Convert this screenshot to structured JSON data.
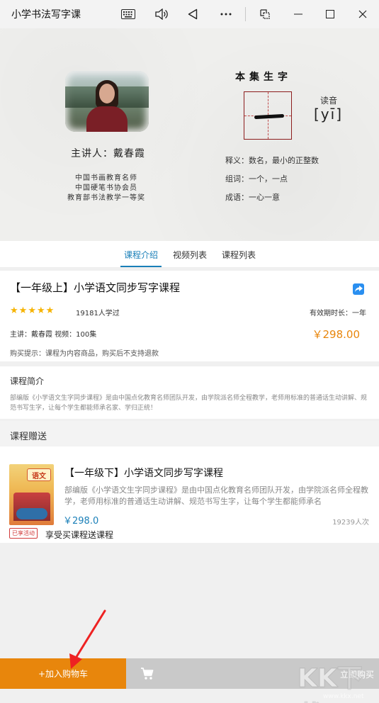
{
  "window": {
    "title": "小学书法写字课",
    "controls": [
      "keyboard-icon",
      "volume-icon",
      "back-icon",
      "more-icon",
      "snap-icon",
      "minimize-icon",
      "maximize-icon",
      "close-icon"
    ]
  },
  "banner": {
    "speaker": "主讲人：戴春霞",
    "credentials": [
      "中国书画教育名师",
      "中国硬笔书协会员",
      "教育部书法教学一等奖"
    ],
    "character_title": "本集生字",
    "character": "一",
    "pinyin_label": "读音",
    "pinyin": "[yī]",
    "meaning": "释义：数名，最小的正整数",
    "phrases": "组词：一个，一点",
    "idiom": "成语：一心一意"
  },
  "tabs": [
    {
      "label": "课程介绍",
      "active": true
    },
    {
      "label": "视频列表",
      "active": false
    },
    {
      "label": "课程列表",
      "active": false
    }
  ],
  "course": {
    "title": "【一年级上】小学语文同步写字课程",
    "rating": 5,
    "learners": "19181人学过",
    "validity": "有效期时长：一年",
    "meta": "主讲：戴春霞   视频：100集",
    "price": "￥298.00",
    "tip": "购买提示：课程为内容商品，购买后不支持退款"
  },
  "intro": {
    "heading": "课程简介",
    "body": "部编版《小学语文生字同步课程》是由中国点化教育名师团队开发，由学院派名师全程教学，老师用标准的普通话生动讲解、规范书写生字，让每个学生都能师承名家、学归正统！"
  },
  "gift": {
    "heading": "课程赠送",
    "cover_label": "语文",
    "title": "【一年级下】小学语文同步写字课程",
    "description": "部编版《小学语文生字同步课程》是由中国点化教育名师团队开发，由学院派名师全程教学，老师用标准的普通话生动讲解、规范书写生字，让每个学生都能师承名",
    "price": "￥298.0",
    "count": "19239人次",
    "badge": "已享活动",
    "promo": "享受买课程送课程"
  },
  "bottom": {
    "add_to_cart": "+加入购物车",
    "buy": "立即购买"
  },
  "watermark": {
    "big": "KK下载",
    "url": "www.kkx.net"
  },
  "colors": {
    "accent_blue": "#1a7fb8",
    "price_orange": "#e8860c",
    "star": "#f6b300"
  }
}
